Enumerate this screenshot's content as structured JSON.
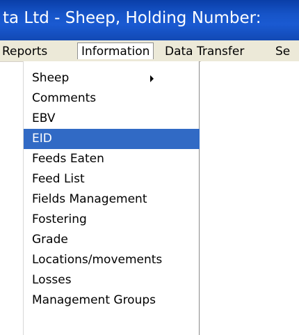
{
  "window": {
    "title": "ta Ltd  -  Sheep,  Holding Number:"
  },
  "menubar": {
    "items": [
      {
        "label": "Reports"
      },
      {
        "label": "Information"
      },
      {
        "label": "Data Transfer"
      },
      {
        "label": "Se"
      }
    ]
  },
  "dropdown": {
    "items": [
      {
        "label": "Sheep",
        "has_submenu": true
      },
      {
        "label": "Comments"
      },
      {
        "label": "EBV"
      },
      {
        "label": "EID",
        "selected": true
      },
      {
        "label": "Feeds Eaten"
      },
      {
        "label": "Feed List"
      },
      {
        "label": "Fields Management"
      },
      {
        "label": "Fostering"
      },
      {
        "label": "Grade"
      },
      {
        "label": "Locations/movements"
      },
      {
        "label": "Losses"
      },
      {
        "label": "Management Groups"
      }
    ]
  },
  "colors": {
    "title_bar": "#1654c8",
    "menu_bar": "#ece9d8",
    "selection": "#316ac5"
  }
}
